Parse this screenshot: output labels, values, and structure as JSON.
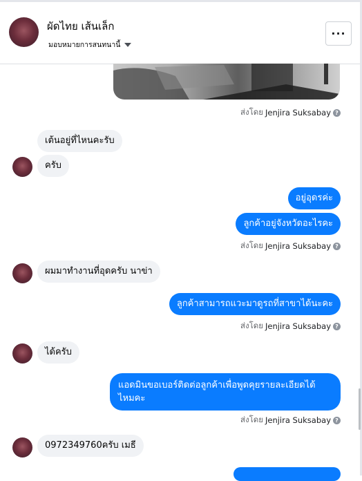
{
  "header": {
    "name": "ผัดไทย เส้นเล็ก",
    "assign_label": "มอบหมายการสนทนานี้",
    "more_label": "···"
  },
  "sent_by": {
    "prefix": "ส่งโดย",
    "name": "Jenjira Suksabay",
    "help": "?"
  },
  "messages": [
    {
      "dir": "in",
      "text": "เต้นอยู่ที่ไหนคะรับ"
    },
    {
      "dir": "in",
      "text": "ครับ"
    },
    {
      "dir": "out",
      "text": "อยู่อุดรค่ะ"
    },
    {
      "dir": "out",
      "text": "ลูกค้าอยู่จังหวัดอะไรคะ"
    },
    {
      "dir": "in",
      "text": "ผมมาทำงานที่อุดครับ นาข่า"
    },
    {
      "dir": "out",
      "text": "ลูกค้าสามารถแวะมาดูรถที่สาขาได้นะคะ"
    },
    {
      "dir": "in",
      "text": "ได้ครับ"
    },
    {
      "dir": "out",
      "text": "แอดมินขอเบอร์ติดต่อลูกค้าเพื่อพูดคุยรายละเอียดได้ไหมคะ",
      "lines": [
        "แอดมินขอเบอร์ติดต่อลูกค้าเพื่อพูดคุยรายละเอียดได้",
        "ไหมคะ"
      ]
    },
    {
      "dir": "in",
      "text": "0972349760ครับ เมธี"
    }
  ],
  "colors": {
    "outgoing": "#0a7cff",
    "incoming": "#f0f2f5",
    "meta": "#65676b"
  }
}
